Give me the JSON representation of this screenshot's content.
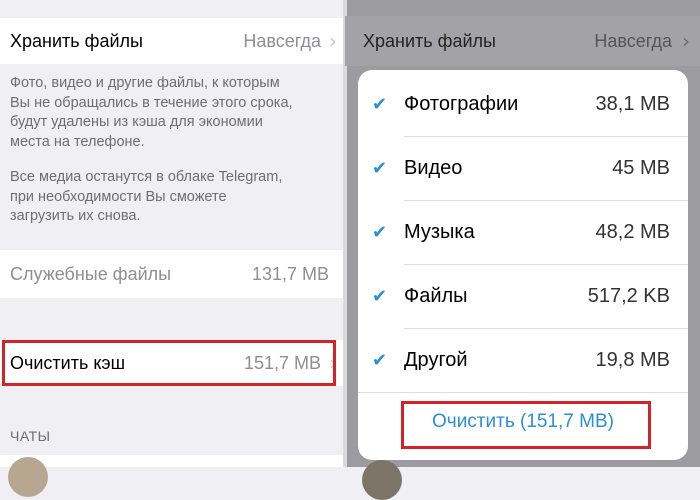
{
  "left": {
    "keep_files": {
      "label": "Хранить файлы",
      "value": "Навсегда",
      "chevron": "›"
    },
    "description": [
      "Фото, видео и другие файлы, к которым",
      "Вы не обращались в течение этого срока,",
      "будут удалены из кэша для экономии",
      "места на телефоне.",
      "",
      "Все медиа останутся в облаке Telegram,",
      "при необходимости Вы сможете",
      "загрузить их снова."
    ],
    "service_files": {
      "label": "Служебные файлы",
      "value": "131,7 MB"
    },
    "clear_cache": {
      "label": "Очистить кэш",
      "value": "151,7 MB",
      "chevron": "›"
    },
    "chats_header": "ЧАТЫ"
  },
  "right": {
    "keep_files": {
      "label": "Хранить файлы",
      "value": "Навсегда",
      "chevron": "›"
    },
    "options": [
      {
        "check": "✔",
        "name": "Фотографии",
        "size": "38,1 MB"
      },
      {
        "check": "✔",
        "name": "Видео",
        "size": "45 MB"
      },
      {
        "check": "✔",
        "name": "Музыка",
        "size": "48,2 MB"
      },
      {
        "check": "✔",
        "name": "Файлы",
        "size": "517,2 KB"
      },
      {
        "check": "✔",
        "name": "Другой",
        "size": "19,8 MB"
      }
    ],
    "clear_button": "Очистить (151,7 MB)"
  },
  "colors": {
    "accent": "#2d8ed6",
    "highlight": "#d0232a",
    "overlay": "#9c9ca0"
  }
}
